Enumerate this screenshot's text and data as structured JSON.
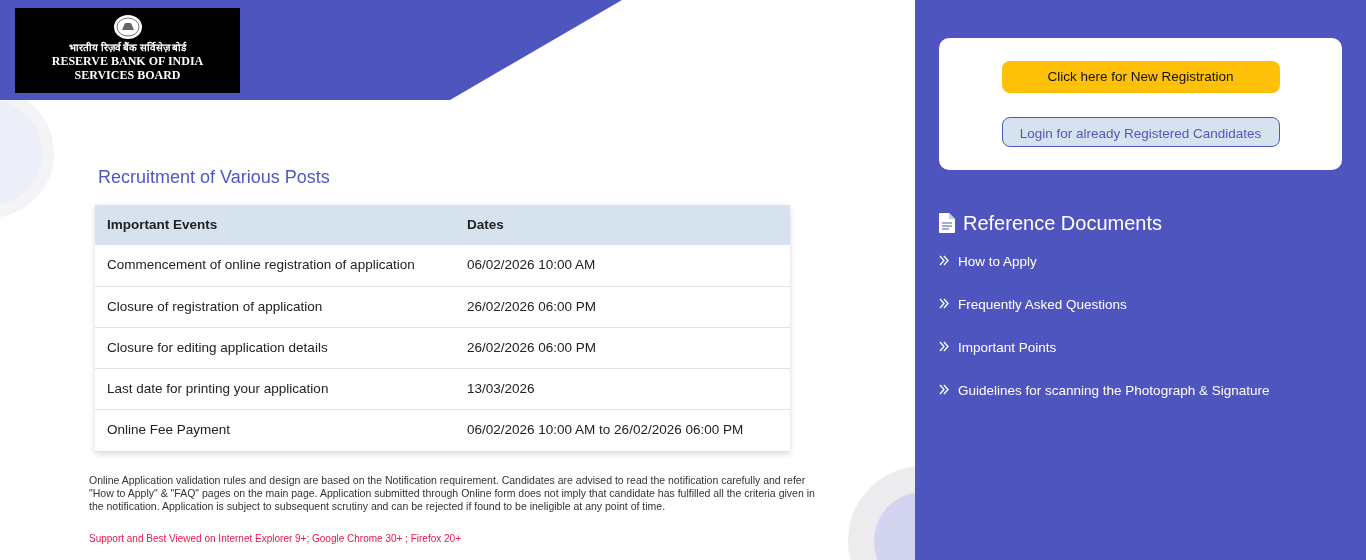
{
  "logo": {
    "hindi": "भारतीय रिज़र्व बैंक सर्विसेज़ बोर्ड",
    "lines": [
      "RESERVE BANK OF INDIA",
      "SERVICES BOARD"
    ]
  },
  "title": "Recruitment of Various Posts",
  "table": {
    "columns": [
      "Important Events",
      "Dates"
    ],
    "rows": [
      [
        "Commencement of online registration of application",
        "06/02/2026 10:00 AM"
      ],
      [
        "Closure of registration of application",
        "26/02/2026 06:00 PM"
      ],
      [
        "Closure for editing application details",
        "26/02/2026 06:00 PM"
      ],
      [
        "Last date for printing your application",
        "13/03/2026"
      ],
      [
        "Online Fee Payment",
        "06/02/2026 10:00 AM to 26/02/2026 06:00 PM"
      ]
    ]
  },
  "notice": "Online Application validation rules and design are based on the Notification requirement. Candidates are advised to read the notification carefully and refer \"How to Apply\" & \"FAQ\" pages on the main page. Application submitted through Online form does not imply that candidate has fulfilled all the criteria given in the notification. Application is subject to subsequent scrutiny and can be rejected if found to be ineligible at any point of time.",
  "browser_note": "Support and Best Viewed on Internet Explorer 9+; Google Chrome 30+ ; Firefox 20+",
  "buttons": [
    {
      "label": "Click here for New Registration",
      "kind": "primary"
    },
    {
      "label": "Login for already Registered Candidates",
      "kind": "outline"
    }
  ],
  "reference": {
    "heading": "Reference Documents",
    "links": [
      "How to Apply",
      "Frequently Asked Questions",
      "Important Points",
      "Guidelines for scanning the Photograph & Signature"
    ]
  }
}
